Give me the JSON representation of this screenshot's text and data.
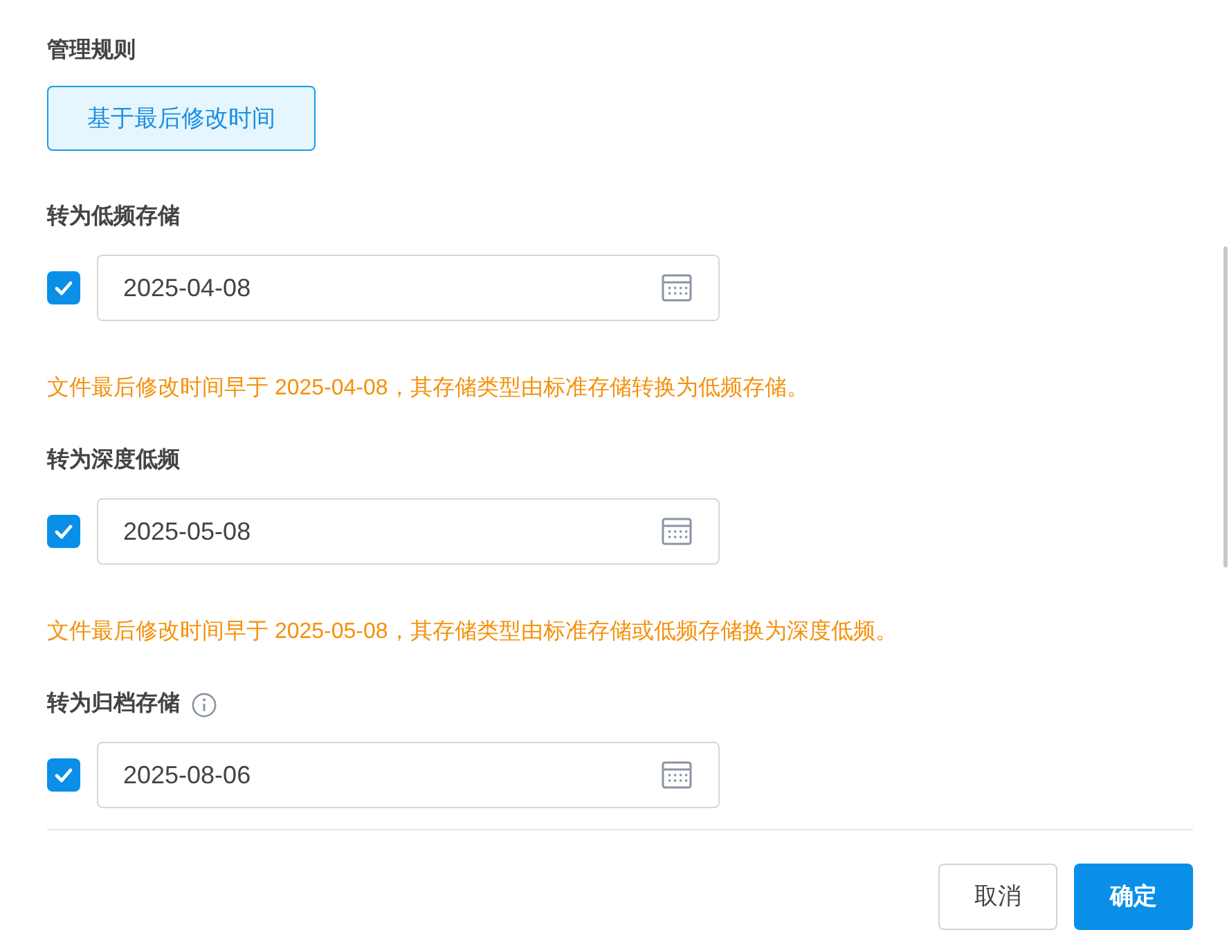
{
  "title": "管理规则",
  "rule_options": [
    {
      "label": "基于最后修改时间",
      "selected": true
    }
  ],
  "rules": [
    {
      "label": "转为低频存储",
      "info": false,
      "checked": true,
      "value": "2025-04-08",
      "note": "文件最后修改时间早于 2025-04-08，其存储类型由标准存储转换为低频存储。"
    },
    {
      "label": "转为深度低频",
      "info": false,
      "checked": true,
      "value": "2025-05-08",
      "note": "文件最后修改时间早于 2025-05-08，其存储类型由标准存储或低频存储换为深度低频。"
    },
    {
      "label": "转为归档存储",
      "info": true,
      "checked": true,
      "value": "2025-08-06"
    }
  ],
  "buttons": [
    {
      "label": "取消",
      "kind": "secondary"
    },
    {
      "label": "确定",
      "kind": "primary"
    }
  ]
}
